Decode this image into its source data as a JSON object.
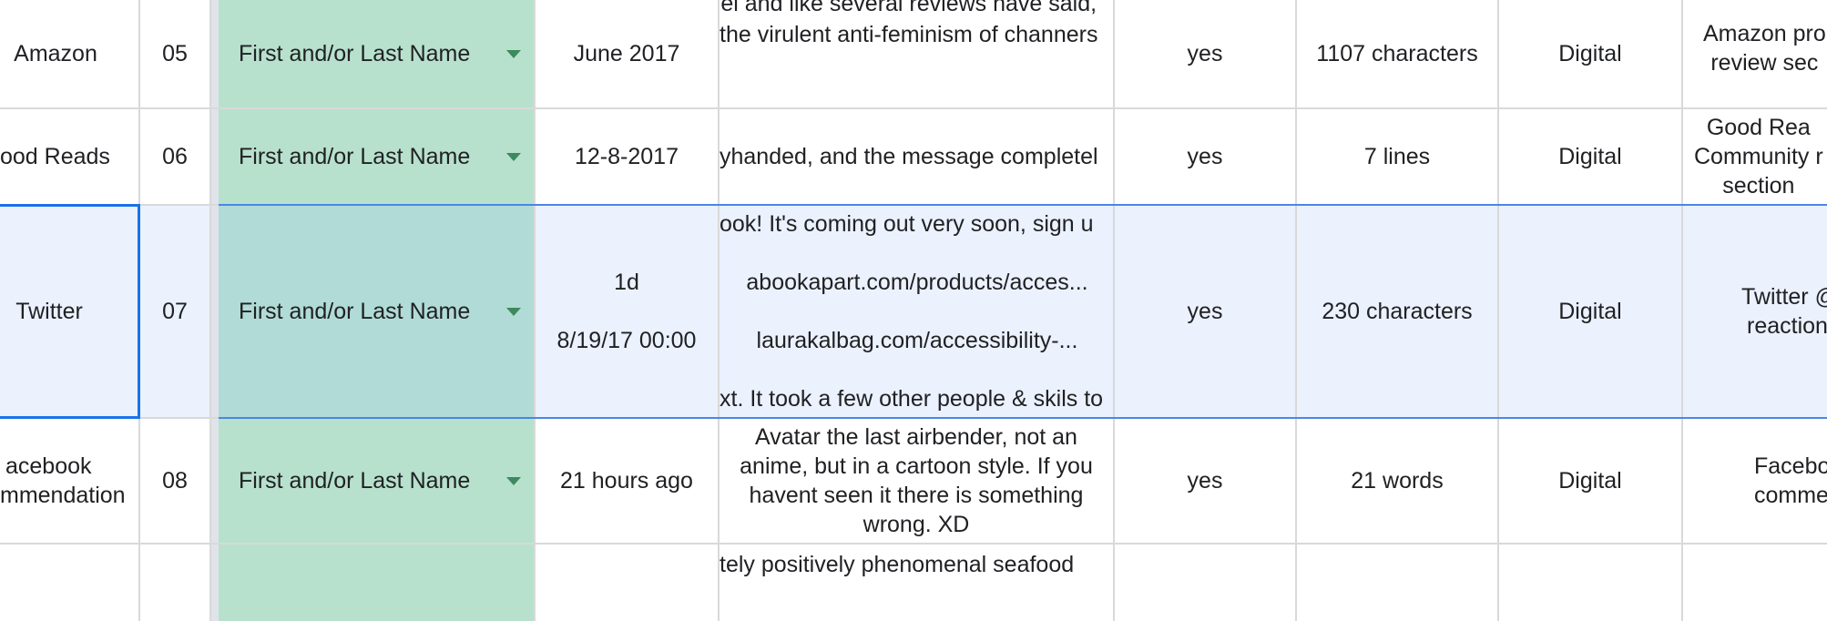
{
  "rows": [
    {
      "source": "Amazon",
      "num": "05",
      "name": "First and/or Last Name",
      "date": "June 2017",
      "text_lines": [
        "el and like several reviews have said,",
        "the virulent anti-feminism of channers"
      ],
      "answer": "yes",
      "length": "1107 characters",
      "medium": "Digital",
      "location": [
        "Amazon pro",
        "review sec"
      ]
    },
    {
      "source": "ood Reads",
      "num": "06",
      "name": "First and/or Last Name",
      "date": "12-8-2017",
      "text_lines": [
        "yhanded, and the message completel"
      ],
      "answer": "yes",
      "length": "7 lines",
      "medium": "Digital",
      "location": [
        "Good Rea",
        "Community r",
        "section"
      ]
    },
    {
      "source": "Twitter",
      "num": "07",
      "name": "First and/or Last Name",
      "date_lines": [
        "1d",
        "8/19/17 00:00"
      ],
      "text_lines": [
        "ook! It's coming out very soon, sign u",
        "abookapart.com/products/acces...",
        "laurakalbag.com/accessibility-...",
        "xt. It took a few other people & skils to"
      ],
      "answer": "yes",
      "length": "230 characters",
      "medium": "Digital",
      "location": [
        "Twitter @",
        "reaction"
      ]
    },
    {
      "source_lines": [
        "acebook",
        "mmendation"
      ],
      "num": "08",
      "name": "First and/or Last Name",
      "date": "21 hours ago",
      "text_lines": [
        "Avatar the last airbender, not an",
        "anime, but in a cartoon style. If you",
        "havent seen it there is something",
        "wrong. XD"
      ],
      "answer": "yes",
      "length": "21 words",
      "medium": "Digital",
      "location": [
        "Faceboo",
        "commen"
      ]
    },
    {
      "text_lines": [
        "tely positively phenomenal seafood"
      ]
    }
  ],
  "colors": {
    "name_fill": "#b7e1cd",
    "selection": "#1a73e8",
    "selected_row": "#ebf1fd"
  },
  "icons": {
    "dropdown": "chevron-down-icon"
  }
}
